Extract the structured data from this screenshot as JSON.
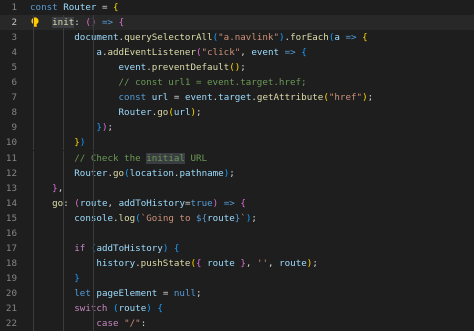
{
  "editor": {
    "colors": {
      "background": "#1e1e1e",
      "active_line": "#282828",
      "line_number": "#858585",
      "keyword": "#569cd6",
      "control": "#c586c0",
      "variable": "#9cdcfe",
      "function": "#dcdcaa",
      "string": "#ce9178",
      "comment": "#6a9955"
    },
    "lines": [
      {
        "num": "1",
        "tokens": [
          [
            "k",
            "const"
          ],
          [
            "p",
            " "
          ],
          [
            "v",
            "Router"
          ],
          [
            "p",
            " = "
          ],
          [
            "b1",
            "{"
          ]
        ]
      },
      {
        "num": "2",
        "tokens": [
          [
            "p",
            "    "
          ],
          [
            "f hl",
            "init"
          ],
          [
            "p",
            ": "
          ],
          [
            "b2",
            "()"
          ],
          [
            "p",
            " "
          ],
          [
            "k",
            "=>"
          ],
          [
            "p",
            " "
          ],
          [
            "b2",
            "{"
          ]
        ]
      },
      {
        "num": "3",
        "tokens": [
          [
            "p",
            "        "
          ],
          [
            "v",
            "document"
          ],
          [
            "p",
            "."
          ],
          [
            "f",
            "querySelectorAll"
          ],
          [
            "b3",
            "("
          ],
          [
            "s",
            "\"a.navlink\""
          ],
          [
            "b3",
            ")"
          ],
          [
            "p",
            "."
          ],
          [
            "f",
            "forEach"
          ],
          [
            "b3",
            "("
          ],
          [
            "v",
            "a"
          ],
          [
            "p",
            " "
          ],
          [
            "k",
            "=>"
          ],
          [
            "p",
            " "
          ],
          [
            "b1",
            "{"
          ]
        ]
      },
      {
        "num": "4",
        "tokens": [
          [
            "p",
            "            "
          ],
          [
            "v",
            "a"
          ],
          [
            "p",
            "."
          ],
          [
            "f",
            "addEventListener"
          ],
          [
            "b2",
            "("
          ],
          [
            "s",
            "\"click\""
          ],
          [
            "p",
            ", "
          ],
          [
            "v",
            "event"
          ],
          [
            "p",
            " "
          ],
          [
            "k",
            "=>"
          ],
          [
            "p",
            " "
          ],
          [
            "b3",
            "{"
          ]
        ]
      },
      {
        "num": "5",
        "tokens": [
          [
            "p",
            "                "
          ],
          [
            "v",
            "event"
          ],
          [
            "p",
            "."
          ],
          [
            "f",
            "preventDefault"
          ],
          [
            "b1",
            "()"
          ],
          [
            "p",
            ";"
          ]
        ]
      },
      {
        "num": "6",
        "tokens": [
          [
            "p",
            "                "
          ],
          [
            "cm",
            "// const url1 = event.target.href;"
          ]
        ]
      },
      {
        "num": "7",
        "tokens": [
          [
            "p",
            "                "
          ],
          [
            "k",
            "const"
          ],
          [
            "p",
            " "
          ],
          [
            "v",
            "url"
          ],
          [
            "p",
            " = "
          ],
          [
            "v",
            "event"
          ],
          [
            "p",
            "."
          ],
          [
            "v",
            "target"
          ],
          [
            "p",
            "."
          ],
          [
            "f",
            "getAttribute"
          ],
          [
            "b1",
            "("
          ],
          [
            "s",
            "\"href\""
          ],
          [
            "b1",
            ")"
          ],
          [
            "p",
            ";"
          ]
        ]
      },
      {
        "num": "8",
        "tokens": [
          [
            "p",
            "                "
          ],
          [
            "v",
            "Router"
          ],
          [
            "p",
            "."
          ],
          [
            "f",
            "go"
          ],
          [
            "b1",
            "("
          ],
          [
            "v",
            "url"
          ],
          [
            "b1",
            ")"
          ],
          [
            "p",
            ";"
          ]
        ]
      },
      {
        "num": "9",
        "tokens": [
          [
            "p",
            "            "
          ],
          [
            "b3",
            "}"
          ],
          [
            "b2",
            ")"
          ],
          [
            "p",
            ";"
          ]
        ]
      },
      {
        "num": "10",
        "tokens": [
          [
            "p",
            "        "
          ],
          [
            "b1",
            "}"
          ],
          [
            "b3",
            ")"
          ]
        ]
      },
      {
        "num": "11",
        "tokens": [
          [
            "p",
            "        "
          ],
          [
            "cm",
            "// Check the "
          ],
          [
            "cm hl",
            "initial"
          ],
          [
            "cm",
            " URL"
          ]
        ]
      },
      {
        "num": "12",
        "tokens": [
          [
            "p",
            "        "
          ],
          [
            "v",
            "Router"
          ],
          [
            "p",
            "."
          ],
          [
            "f",
            "go"
          ],
          [
            "b3",
            "("
          ],
          [
            "v",
            "location"
          ],
          [
            "p",
            "."
          ],
          [
            "v",
            "pathname"
          ],
          [
            "b3",
            ")"
          ],
          [
            "p",
            ";"
          ]
        ]
      },
      {
        "num": "13",
        "tokens": [
          [
            "p",
            "    "
          ],
          [
            "b2",
            "}"
          ],
          [
            "p",
            ","
          ]
        ]
      },
      {
        "num": "14",
        "tokens": [
          [
            "p",
            "    "
          ],
          [
            "f",
            "go"
          ],
          [
            "p",
            ": "
          ],
          [
            "b2",
            "("
          ],
          [
            "v",
            "route"
          ],
          [
            "p",
            ", "
          ],
          [
            "v",
            "addToHistory"
          ],
          [
            "p",
            "="
          ],
          [
            "k",
            "true"
          ],
          [
            "b2",
            ")"
          ],
          [
            "p",
            " "
          ],
          [
            "k",
            "=>"
          ],
          [
            "p",
            " "
          ],
          [
            "b2",
            "{"
          ]
        ]
      },
      {
        "num": "15",
        "tokens": [
          [
            "p",
            "        "
          ],
          [
            "v",
            "console"
          ],
          [
            "p",
            "."
          ],
          [
            "f",
            "log"
          ],
          [
            "b3",
            "("
          ],
          [
            "s",
            "`Going to "
          ],
          [
            "k",
            "${"
          ],
          [
            "v",
            "route"
          ],
          [
            "k",
            "}"
          ],
          [
            "s",
            "`"
          ],
          [
            "b3",
            ")"
          ],
          [
            "p",
            ";"
          ]
        ]
      },
      {
        "num": "16",
        "tokens": []
      },
      {
        "num": "17",
        "tokens": [
          [
            "p",
            "        "
          ],
          [
            "c",
            "if"
          ],
          [
            "p",
            " "
          ],
          [
            "b3",
            "("
          ],
          [
            "v",
            "addToHistory"
          ],
          [
            "b3",
            ")"
          ],
          [
            "p",
            " "
          ],
          [
            "b3",
            "{"
          ]
        ]
      },
      {
        "num": "18",
        "tokens": [
          [
            "p",
            "            "
          ],
          [
            "v",
            "history"
          ],
          [
            "p",
            "."
          ],
          [
            "f",
            "pushState"
          ],
          [
            "b1",
            "("
          ],
          [
            "b2",
            "{"
          ],
          [
            "p",
            " "
          ],
          [
            "v",
            "route"
          ],
          [
            "p",
            " "
          ],
          [
            "b2",
            "}"
          ],
          [
            "p",
            ", "
          ],
          [
            "s",
            "''"
          ],
          [
            "p",
            ", "
          ],
          [
            "v",
            "route"
          ],
          [
            "b1",
            ")"
          ],
          [
            "p",
            ";"
          ]
        ]
      },
      {
        "num": "19",
        "tokens": [
          [
            "p",
            "        "
          ],
          [
            "b3",
            "}"
          ]
        ]
      },
      {
        "num": "20",
        "tokens": [
          [
            "p",
            "        "
          ],
          [
            "k",
            "let"
          ],
          [
            "p",
            " "
          ],
          [
            "v",
            "pageElement"
          ],
          [
            "p",
            " = "
          ],
          [
            "k",
            "null"
          ],
          [
            "p",
            ";"
          ]
        ]
      },
      {
        "num": "21",
        "tokens": [
          [
            "p",
            "        "
          ],
          [
            "c",
            "switch"
          ],
          [
            "p",
            " "
          ],
          [
            "b3",
            "("
          ],
          [
            "v",
            "route"
          ],
          [
            "b3",
            ")"
          ],
          [
            "p",
            " "
          ],
          [
            "b3",
            "{"
          ]
        ]
      },
      {
        "num": "22",
        "tokens": [
          [
            "p",
            "            "
          ],
          [
            "c",
            "case"
          ],
          [
            "p",
            " "
          ],
          [
            "s",
            "\"/\""
          ],
          [
            "p",
            ":"
          ]
        ]
      }
    ]
  }
}
